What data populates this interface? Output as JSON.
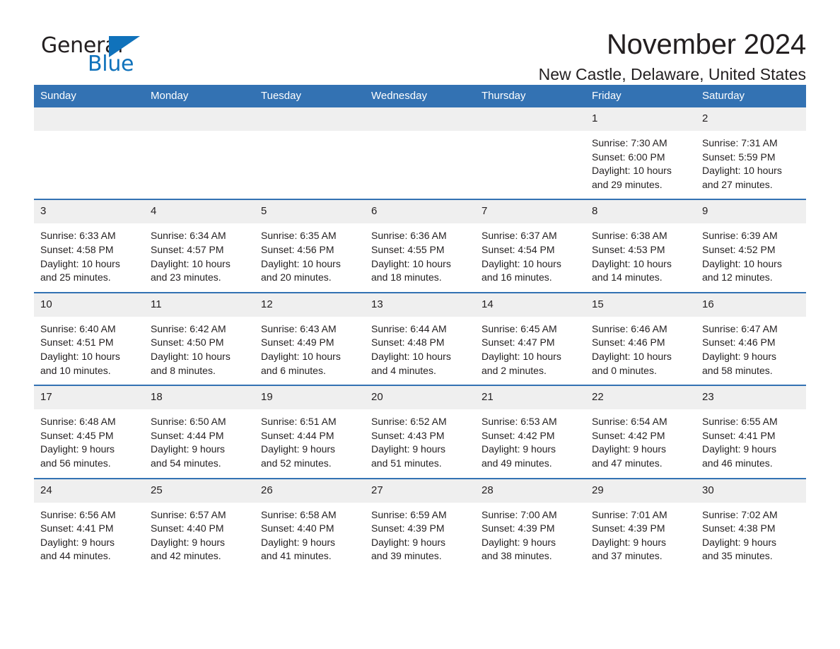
{
  "brand": {
    "name_part1": "General",
    "name_part2": "Blue",
    "triangle_icon": "triangle-icon",
    "accent_color": "#1072bb"
  },
  "header": {
    "month_title": "November 2024",
    "location": "New Castle, Delaware, United States"
  },
  "theme": {
    "header_blue": "#3372b3",
    "daynum_gray": "#efefef",
    "text_dark": "#231f20"
  },
  "calendar": {
    "weekday_headers": [
      "Sunday",
      "Monday",
      "Tuesday",
      "Wednesday",
      "Thursday",
      "Friday",
      "Saturday"
    ],
    "weeks": [
      [
        {
          "day": "",
          "lines": []
        },
        {
          "day": "",
          "lines": []
        },
        {
          "day": "",
          "lines": []
        },
        {
          "day": "",
          "lines": []
        },
        {
          "day": "",
          "lines": []
        },
        {
          "day": "1",
          "lines": [
            "Sunrise: 7:30 AM",
            "Sunset: 6:00 PM",
            "Daylight: 10 hours",
            "and 29 minutes."
          ]
        },
        {
          "day": "2",
          "lines": [
            "Sunrise: 7:31 AM",
            "Sunset: 5:59 PM",
            "Daylight: 10 hours",
            "and 27 minutes."
          ]
        }
      ],
      [
        {
          "day": "3",
          "lines": [
            "Sunrise: 6:33 AM",
            "Sunset: 4:58 PM",
            "Daylight: 10 hours",
            "and 25 minutes."
          ]
        },
        {
          "day": "4",
          "lines": [
            "Sunrise: 6:34 AM",
            "Sunset: 4:57 PM",
            "Daylight: 10 hours",
            "and 23 minutes."
          ]
        },
        {
          "day": "5",
          "lines": [
            "Sunrise: 6:35 AM",
            "Sunset: 4:56 PM",
            "Daylight: 10 hours",
            "and 20 minutes."
          ]
        },
        {
          "day": "6",
          "lines": [
            "Sunrise: 6:36 AM",
            "Sunset: 4:55 PM",
            "Daylight: 10 hours",
            "and 18 minutes."
          ]
        },
        {
          "day": "7",
          "lines": [
            "Sunrise: 6:37 AM",
            "Sunset: 4:54 PM",
            "Daylight: 10 hours",
            "and 16 minutes."
          ]
        },
        {
          "day": "8",
          "lines": [
            "Sunrise: 6:38 AM",
            "Sunset: 4:53 PM",
            "Daylight: 10 hours",
            "and 14 minutes."
          ]
        },
        {
          "day": "9",
          "lines": [
            "Sunrise: 6:39 AM",
            "Sunset: 4:52 PM",
            "Daylight: 10 hours",
            "and 12 minutes."
          ]
        }
      ],
      [
        {
          "day": "10",
          "lines": [
            "Sunrise: 6:40 AM",
            "Sunset: 4:51 PM",
            "Daylight: 10 hours",
            "and 10 minutes."
          ]
        },
        {
          "day": "11",
          "lines": [
            "Sunrise: 6:42 AM",
            "Sunset: 4:50 PM",
            "Daylight: 10 hours",
            "and 8 minutes."
          ]
        },
        {
          "day": "12",
          "lines": [
            "Sunrise: 6:43 AM",
            "Sunset: 4:49 PM",
            "Daylight: 10 hours",
            "and 6 minutes."
          ]
        },
        {
          "day": "13",
          "lines": [
            "Sunrise: 6:44 AM",
            "Sunset: 4:48 PM",
            "Daylight: 10 hours",
            "and 4 minutes."
          ]
        },
        {
          "day": "14",
          "lines": [
            "Sunrise: 6:45 AM",
            "Sunset: 4:47 PM",
            "Daylight: 10 hours",
            "and 2 minutes."
          ]
        },
        {
          "day": "15",
          "lines": [
            "Sunrise: 6:46 AM",
            "Sunset: 4:46 PM",
            "Daylight: 10 hours",
            "and 0 minutes."
          ]
        },
        {
          "day": "16",
          "lines": [
            "Sunrise: 6:47 AM",
            "Sunset: 4:46 PM",
            "Daylight: 9 hours",
            "and 58 minutes."
          ]
        }
      ],
      [
        {
          "day": "17",
          "lines": [
            "Sunrise: 6:48 AM",
            "Sunset: 4:45 PM",
            "Daylight: 9 hours",
            "and 56 minutes."
          ]
        },
        {
          "day": "18",
          "lines": [
            "Sunrise: 6:50 AM",
            "Sunset: 4:44 PM",
            "Daylight: 9 hours",
            "and 54 minutes."
          ]
        },
        {
          "day": "19",
          "lines": [
            "Sunrise: 6:51 AM",
            "Sunset: 4:44 PM",
            "Daylight: 9 hours",
            "and 52 minutes."
          ]
        },
        {
          "day": "20",
          "lines": [
            "Sunrise: 6:52 AM",
            "Sunset: 4:43 PM",
            "Daylight: 9 hours",
            "and 51 minutes."
          ]
        },
        {
          "day": "21",
          "lines": [
            "Sunrise: 6:53 AM",
            "Sunset: 4:42 PM",
            "Daylight: 9 hours",
            "and 49 minutes."
          ]
        },
        {
          "day": "22",
          "lines": [
            "Sunrise: 6:54 AM",
            "Sunset: 4:42 PM",
            "Daylight: 9 hours",
            "and 47 minutes."
          ]
        },
        {
          "day": "23",
          "lines": [
            "Sunrise: 6:55 AM",
            "Sunset: 4:41 PM",
            "Daylight: 9 hours",
            "and 46 minutes."
          ]
        }
      ],
      [
        {
          "day": "24",
          "lines": [
            "Sunrise: 6:56 AM",
            "Sunset: 4:41 PM",
            "Daylight: 9 hours",
            "and 44 minutes."
          ]
        },
        {
          "day": "25",
          "lines": [
            "Sunrise: 6:57 AM",
            "Sunset: 4:40 PM",
            "Daylight: 9 hours",
            "and 42 minutes."
          ]
        },
        {
          "day": "26",
          "lines": [
            "Sunrise: 6:58 AM",
            "Sunset: 4:40 PM",
            "Daylight: 9 hours",
            "and 41 minutes."
          ]
        },
        {
          "day": "27",
          "lines": [
            "Sunrise: 6:59 AM",
            "Sunset: 4:39 PM",
            "Daylight: 9 hours",
            "and 39 minutes."
          ]
        },
        {
          "day": "28",
          "lines": [
            "Sunrise: 7:00 AM",
            "Sunset: 4:39 PM",
            "Daylight: 9 hours",
            "and 38 minutes."
          ]
        },
        {
          "day": "29",
          "lines": [
            "Sunrise: 7:01 AM",
            "Sunset: 4:39 PM",
            "Daylight: 9 hours",
            "and 37 minutes."
          ]
        },
        {
          "day": "30",
          "lines": [
            "Sunrise: 7:02 AM",
            "Sunset: 4:38 PM",
            "Daylight: 9 hours",
            "and 35 minutes."
          ]
        }
      ]
    ]
  }
}
